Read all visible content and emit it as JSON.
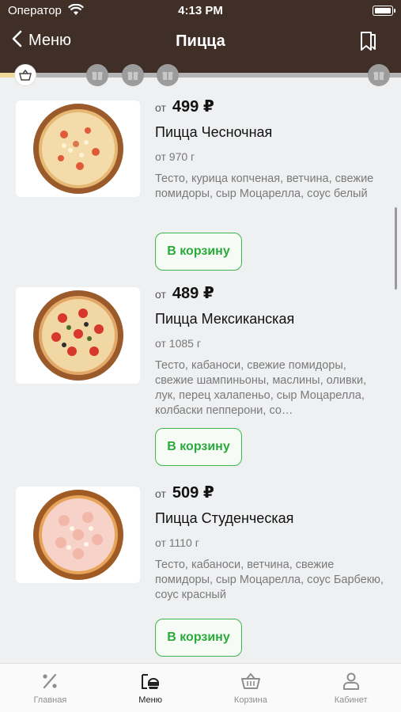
{
  "status": {
    "carrier": "Оператор",
    "time": "4:13 PM"
  },
  "nav": {
    "back_label": "Меню",
    "title": "Пицца"
  },
  "items": [
    {
      "from": "от",
      "price": "499 ₽",
      "name": "Пицца Чесночная",
      "weight": "от 970 г",
      "desc": "Тесто, курица копченая, ветчина, свежие помидоры, сыр Моцарелла, соус белый",
      "button": "В корзину"
    },
    {
      "from": "от",
      "price": "489 ₽",
      "name": "Пицца Мексиканская",
      "weight": "от 1085 г",
      "desc": "Тесто, кабаноси, свежие помидоры, свежие шампиньоны, маслины, оливки, лук, перец халапеньо, сыр Моцарелла, колбаски пепперони, со…",
      "button": "В корзину"
    },
    {
      "from": "от",
      "price": "509 ₽",
      "name": "Пицца Студенческая",
      "weight": "от 1110 г",
      "desc": "Тесто, кабаноси, ветчина, свежие помидоры, сыр Моцарелла, соус Барбекю, соус красный",
      "button": "В корзину"
    }
  ],
  "tabs": [
    {
      "label": "Главная",
      "icon": "percent-icon"
    },
    {
      "label": "Меню",
      "icon": "menu-icon"
    },
    {
      "label": "Корзина",
      "icon": "basket-icon"
    },
    {
      "label": "Кабинет",
      "icon": "user-icon"
    }
  ],
  "colors": {
    "header": "#402f27",
    "accent_green": "#3bb84b",
    "progress_fill": "#f0d79c"
  }
}
